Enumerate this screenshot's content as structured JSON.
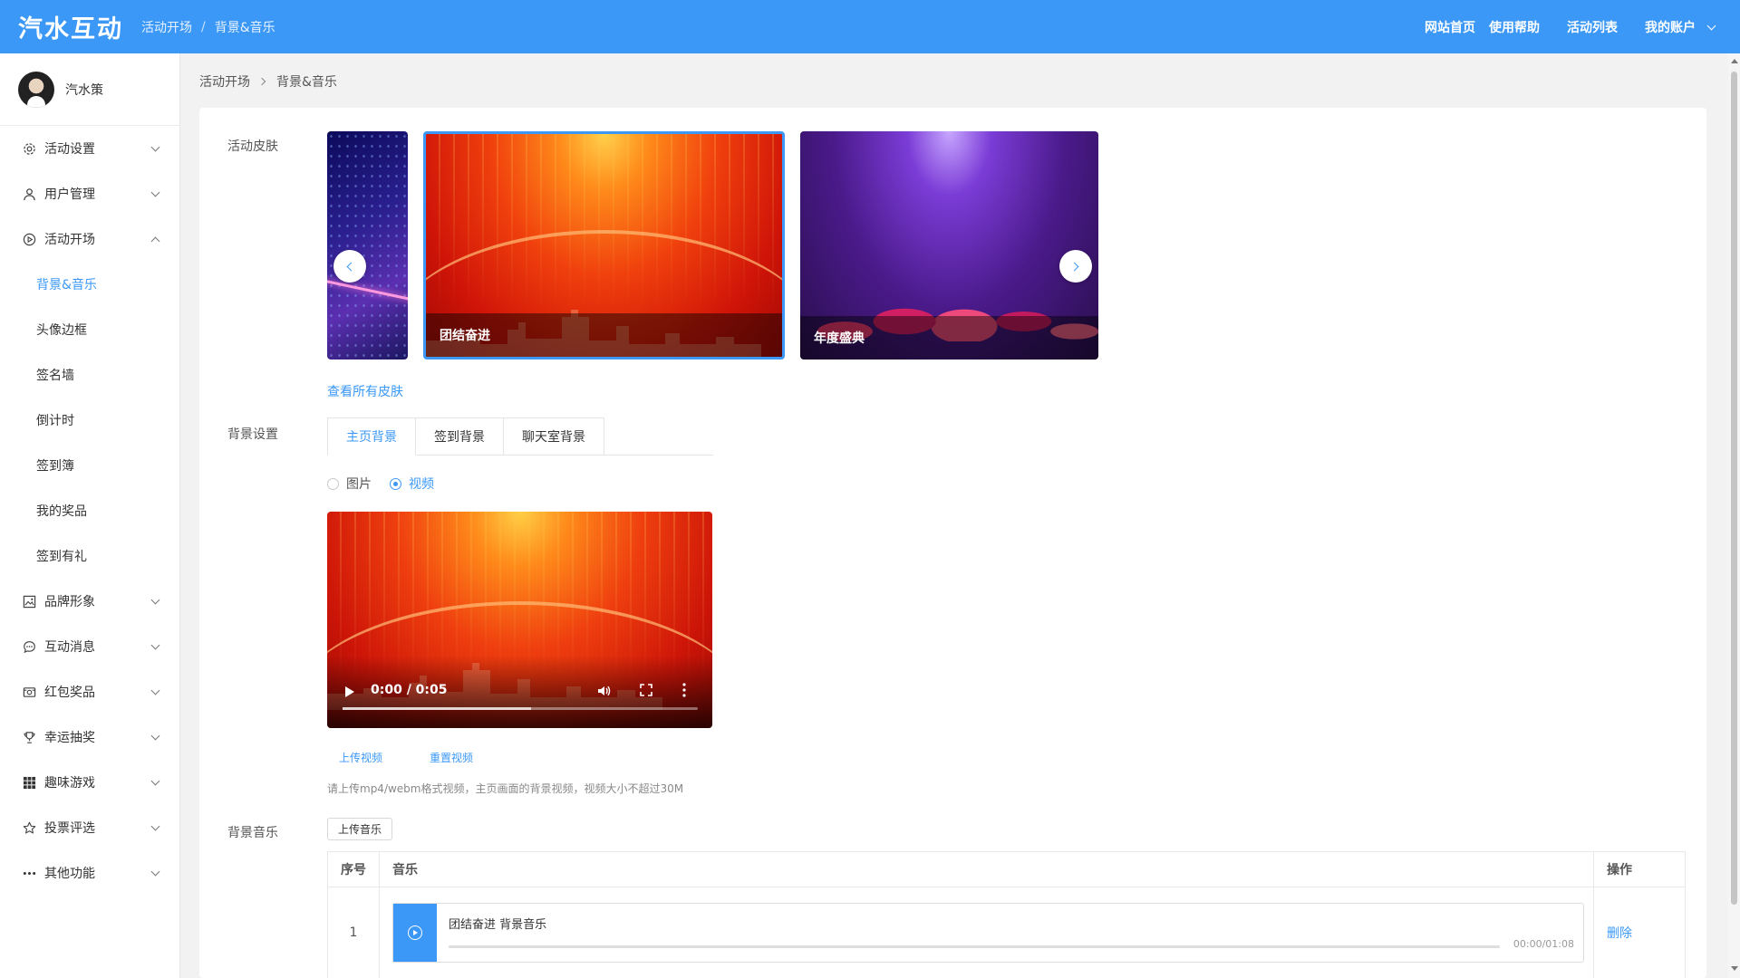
{
  "header": {
    "logo": "汽水互动",
    "crumb_parent": "活动开场",
    "crumb_current": "背景&音乐",
    "nav": {
      "home": "网站首页",
      "help": "使用帮助",
      "activities": "活动列表",
      "account": "我的账户"
    }
  },
  "user": {
    "name": "汽水策"
  },
  "sidebar": {
    "items": [
      {
        "label": "活动设置"
      },
      {
        "label": "用户管理"
      },
      {
        "label": "活动开场"
      },
      {
        "label": "品牌形象"
      },
      {
        "label": "互动消息"
      },
      {
        "label": "红包奖品"
      },
      {
        "label": "幸运抽奖"
      },
      {
        "label": "趣味游戏"
      },
      {
        "label": "投票评选"
      },
      {
        "label": "其他功能"
      }
    ],
    "sub_items": [
      {
        "label": "背景&音乐"
      },
      {
        "label": "头像边框"
      },
      {
        "label": "签名墙"
      },
      {
        "label": "倒计时"
      },
      {
        "label": "签到簿"
      },
      {
        "label": "我的奖品"
      },
      {
        "label": "签到有礼"
      }
    ]
  },
  "breadcrumb": {
    "parent": "活动开场",
    "current": "背景&音乐"
  },
  "skin": {
    "label": "活动皮肤",
    "items": [
      {
        "caption": "团结奋进"
      },
      {
        "caption": "年度盛典"
      }
    ],
    "view_all": "查看所有皮肤"
  },
  "background": {
    "label": "背景设置",
    "tabs": [
      {
        "label": "主页背景"
      },
      {
        "label": "签到背景"
      },
      {
        "label": "聊天室背景"
      }
    ],
    "radio_image": "图片",
    "radio_video": "视频",
    "selected": "视频",
    "video_time": "0:00 / 0:05",
    "video_progress": 0,
    "upload_video": "上传视频",
    "reset_video": "重置视频",
    "hint": "请上传mp4/webm格式视频，主页画面的背景视频，视频大小不超过30M"
  },
  "music": {
    "label": "背景音乐",
    "upload": "上传音乐",
    "columns": {
      "index": "序号",
      "music": "音乐",
      "action": "操作"
    },
    "rows": [
      {
        "index": "1",
        "title": "团结奋进 背景音乐",
        "time": "00:00/01:08",
        "action": "删除"
      }
    ]
  },
  "colors": {
    "primary": "#3b98f6",
    "header_bg": "#3b98f6"
  }
}
